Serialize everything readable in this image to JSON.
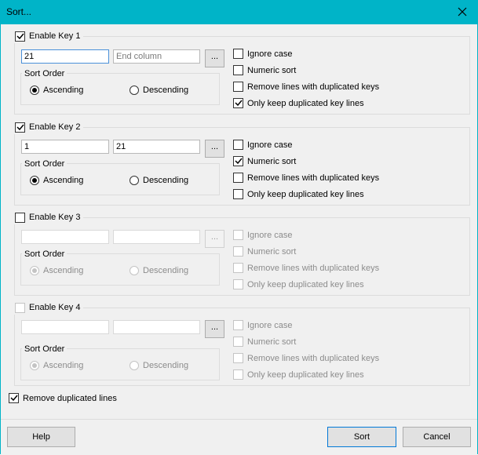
{
  "window": {
    "title": "Sort...",
    "close_glyph": "✕"
  },
  "keys": [
    {
      "enable_label": "Enable Key 1",
      "enabled": true,
      "start_value": "21",
      "start_placeholder": "",
      "end_value": "",
      "end_placeholder": "End column",
      "browse_label": "...",
      "sort_order": {
        "legend": "Sort Order",
        "ascending": "Ascending",
        "descending": "Descending",
        "selected": "ascending"
      },
      "options": [
        {
          "label": "Ignore case",
          "checked": false
        },
        {
          "label": "Numeric sort",
          "checked": false
        },
        {
          "label": "Remove lines with duplicated keys",
          "checked": false
        },
        {
          "label": "Only keep duplicated key lines",
          "checked": true
        }
      ]
    },
    {
      "enable_label": "Enable Key 2",
      "enabled": true,
      "start_value": "1",
      "start_placeholder": "",
      "end_value": "21",
      "end_placeholder": "",
      "browse_label": "...",
      "sort_order": {
        "legend": "Sort Order",
        "ascending": "Ascending",
        "descending": "Descending",
        "selected": "ascending"
      },
      "options": [
        {
          "label": "Ignore case",
          "checked": false
        },
        {
          "label": "Numeric sort",
          "checked": true
        },
        {
          "label": "Remove lines with duplicated keys",
          "checked": false
        },
        {
          "label": "Only keep duplicated key lines",
          "checked": false
        }
      ]
    },
    {
      "enable_label": "Enable Key 3",
      "enabled": false,
      "start_value": "",
      "start_placeholder": "",
      "end_value": "",
      "end_placeholder": "",
      "browse_label": "...",
      "sort_order": {
        "legend": "Sort Order",
        "ascending": "Ascending",
        "descending": "Descending",
        "selected": "ascending"
      },
      "options": [
        {
          "label": "Ignore case",
          "checked": false
        },
        {
          "label": "Numeric sort",
          "checked": false
        },
        {
          "label": "Remove lines with duplicated keys",
          "checked": false
        },
        {
          "label": "Only keep duplicated key lines",
          "checked": false
        }
      ]
    },
    {
      "enable_label": "Enable Key 4",
      "enabled": false,
      "start_value": "",
      "start_placeholder": "",
      "end_value": "",
      "end_placeholder": "",
      "browse_label": "...",
      "sort_order": {
        "legend": "Sort Order",
        "ascending": "Ascending",
        "descending": "Descending",
        "selected": "ascending"
      },
      "options": [
        {
          "label": "Ignore case",
          "checked": false
        },
        {
          "label": "Numeric sort",
          "checked": false
        },
        {
          "label": "Remove lines with duplicated keys",
          "checked": false
        },
        {
          "label": "Only keep duplicated key lines",
          "checked": false
        }
      ]
    }
  ],
  "remove_duplicated_lines": {
    "label": "Remove duplicated lines",
    "checked": true
  },
  "buttons": {
    "help": "Help",
    "sort": "Sort",
    "cancel": "Cancel"
  },
  "colors": {
    "titlebar": "#00b4c8",
    "accent": "#0078d7"
  }
}
